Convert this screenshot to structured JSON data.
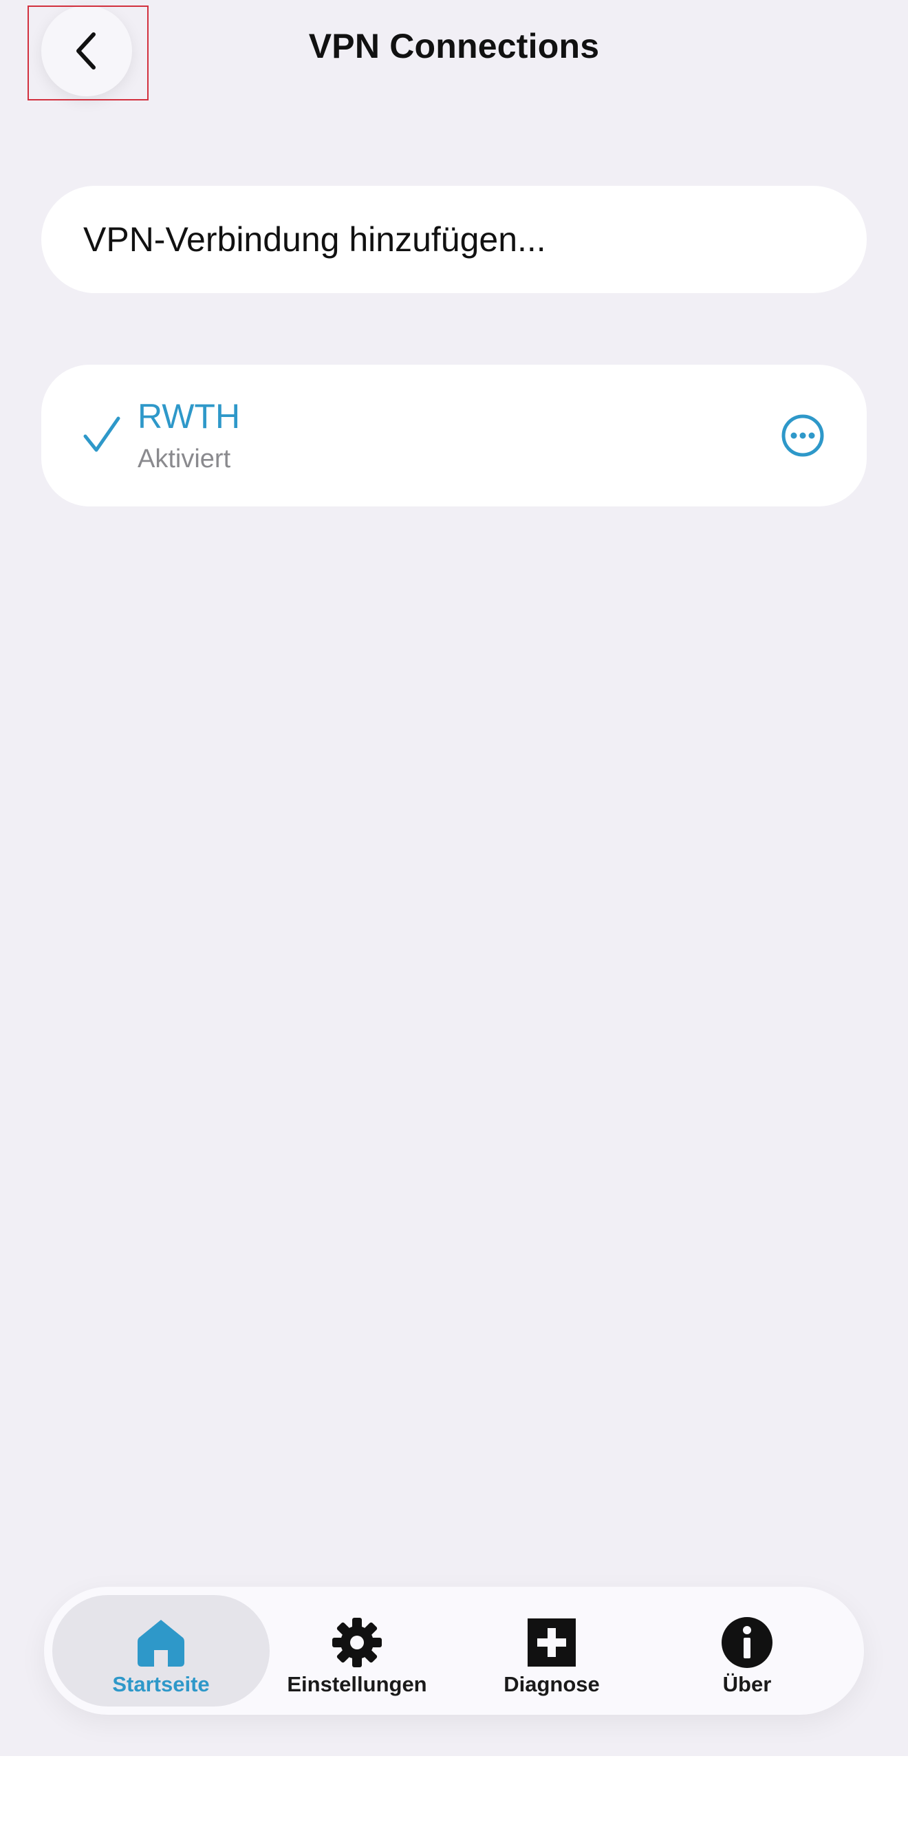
{
  "header": {
    "title": "VPN Connections",
    "back_icon": "chevron-left-icon"
  },
  "add_vpn": {
    "label": "VPN-Verbindung hinzufügen..."
  },
  "vpn_list": [
    {
      "name": "RWTH",
      "status": "Aktiviert",
      "selected": true,
      "check_icon": "checkmark-icon",
      "more_icon": "ellipsis-circle-icon"
    }
  ],
  "tabbar": {
    "tabs": [
      {
        "label": "Startseite",
        "icon": "home-icon",
        "active": true
      },
      {
        "label": "Einstellungen",
        "icon": "gear-icon",
        "active": false
      },
      {
        "label": "Diagnose",
        "icon": "plus-square-icon",
        "active": false
      },
      {
        "label": "Über",
        "icon": "info-circle-icon",
        "active": false
      }
    ]
  },
  "colors": {
    "accent": "#2e98c9",
    "background": "#f1eff5",
    "card": "#ffffff",
    "secondary_text": "#8a8a8e",
    "highlight": "#d2303e"
  }
}
